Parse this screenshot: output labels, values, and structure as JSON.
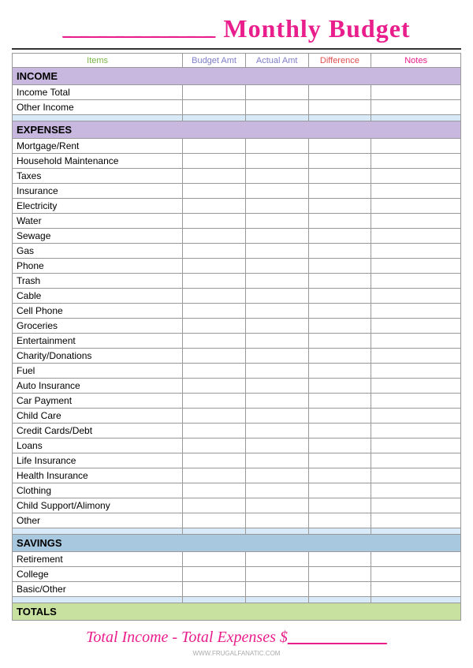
{
  "header": {
    "underline_text": "_ _ _ _ _ _ _ _ _",
    "title": "Monthly Budget"
  },
  "table": {
    "columns": {
      "items": "Items",
      "budget": "Budget Amt",
      "actual": "Actual Amt",
      "diff": "Difference",
      "notes": "Notes"
    },
    "sections": [
      {
        "id": "income",
        "label": "INCOME",
        "rows": [
          "Income Total",
          "Other Income"
        ]
      },
      {
        "id": "expenses",
        "label": "EXPENSES",
        "rows": [
          "Mortgage/Rent",
          "Household Maintenance",
          "Taxes",
          "Insurance",
          "Electricity",
          "Water",
          "Sewage",
          "Gas",
          "Phone",
          "Trash",
          "Cable",
          "Cell Phone",
          "Groceries",
          "Entertainment",
          "Charity/Donations",
          "Fuel",
          "Auto Insurance",
          "Car Payment",
          "Child Care",
          "Credit Cards/Debt",
          "Loans",
          "Life Insurance",
          "Health Insurance",
          "Clothing",
          "Child Support/Alimony",
          "Other"
        ]
      },
      {
        "id": "savings",
        "label": "SAVINGS",
        "rows": [
          "Retirement",
          "College",
          "Basic/Other"
        ]
      },
      {
        "id": "totals",
        "label": "TOTALS",
        "rows": []
      }
    ]
  },
  "footer": {
    "text": "Total Income - Total Expenses $",
    "underline": "_ _ _ _ _ _ _"
  },
  "watermark": "WWW.FRUGALFANATIC.COM"
}
